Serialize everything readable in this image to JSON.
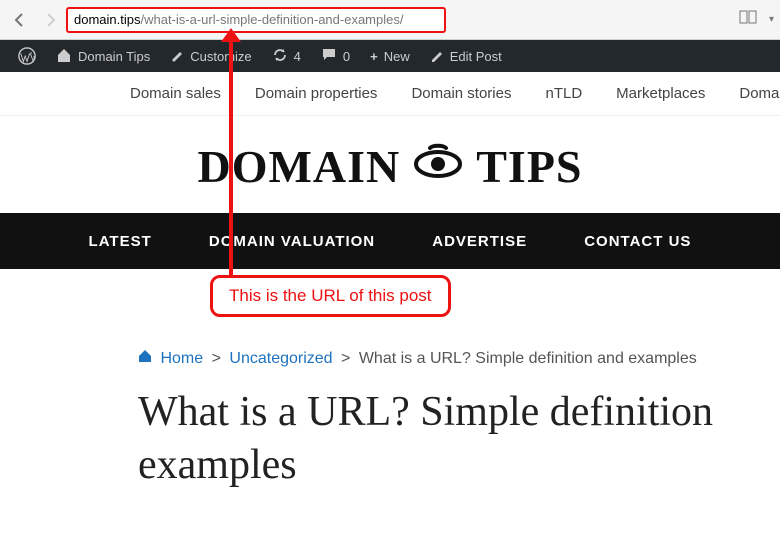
{
  "browser": {
    "url_host": "domain.tips",
    "url_path": "/what-is-a-url-simple-definition-and-examples/"
  },
  "wp_bar": {
    "site_name": "Domain Tips",
    "customize": "Customize",
    "updates_count": "4",
    "comments_count": "0",
    "new_label": "New",
    "edit_post": "Edit Post"
  },
  "subnav": {
    "items": [
      "Domain sales",
      "Domain properties",
      "Domain stories",
      "nTLD",
      "Marketplaces",
      "Domain ex"
    ]
  },
  "logo": {
    "left": "DOMAIN",
    "right": "TIPS"
  },
  "mainnav": {
    "items": [
      "LATEST",
      "DOMAIN VALUATION",
      "ADVERTISE",
      "CONTACT US"
    ]
  },
  "annotation": {
    "text": "This is the URL of this post"
  },
  "breadcrumb": {
    "home": "Home",
    "cat": "Uncategorized",
    "current": "What is a URL? Simple definition and examples",
    "sep": ">"
  },
  "post": {
    "title_line1": "What is a URL? Simple definition",
    "title_line2": "examples"
  }
}
